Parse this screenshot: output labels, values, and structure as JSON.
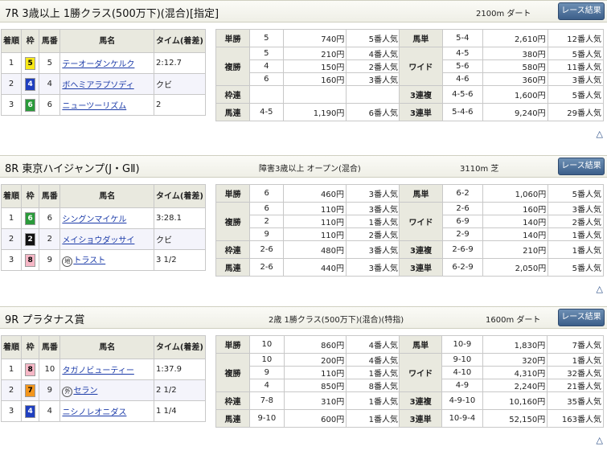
{
  "races": [
    {
      "title": "7R 3歳以上 1勝クラス(500万下)(混合)[指定]",
      "condition": "",
      "distance": "2100m ダート",
      "button": "レース結果",
      "headers": [
        "着順",
        "枠",
        "馬番",
        "馬名",
        "タイム(着差)"
      ],
      "results": [
        {
          "pos": "1",
          "waku": "5",
          "num": "5",
          "name": "テーオーダンケルク",
          "time": "2:12.7"
        },
        {
          "pos": "2",
          "waku": "4",
          "num": "4",
          "name": "ボヘミアラプソディ",
          "time": "クビ"
        },
        {
          "pos": "3",
          "waku": "6",
          "num": "6",
          "name": "ニューツーリズム",
          "time": "2"
        }
      ],
      "payout_left": [
        {
          "label": "単勝",
          "rows": [
            [
              "5",
              "740円",
              "5番人気"
            ]
          ]
        },
        {
          "label": "複勝",
          "rows": [
            [
              "5",
              "210円",
              "4番人気"
            ],
            [
              "4",
              "150円",
              "2番人気"
            ],
            [
              "6",
              "160円",
              "3番人気"
            ]
          ]
        },
        {
          "label": "枠連",
          "rows": [
            [
              "",
              "",
              ""
            ]
          ]
        },
        {
          "label": "馬連",
          "rows": [
            [
              "4-5",
              "1,190円",
              "6番人気"
            ]
          ]
        }
      ],
      "payout_right": [
        {
          "label": "馬単",
          "rows": [
            [
              "5-4",
              "2,610円",
              "12番人気"
            ]
          ]
        },
        {
          "label": "ワイド",
          "rows": [
            [
              "4-5",
              "380円",
              "5番人気"
            ],
            [
              "5-6",
              "580円",
              "11番人気"
            ],
            [
              "4-6",
              "360円",
              "3番人気"
            ]
          ]
        },
        {
          "label": "3連複",
          "rows": [
            [
              "4-5-6",
              "1,600円",
              "5番人気"
            ]
          ]
        },
        {
          "label": "3連単",
          "rows": [
            [
              "5-4-6",
              "9,240円",
              "29番人気"
            ]
          ]
        }
      ]
    },
    {
      "title": "8R 東京ハイジャンプ(J・GⅡ)",
      "condition": "障害3歳以上 オープン(混合)",
      "distance": "3110m 芝",
      "button": "レース結果",
      "headers": [
        "着順",
        "枠",
        "馬番",
        "馬名",
        "タイム(着差)"
      ],
      "results": [
        {
          "pos": "1",
          "waku": "6",
          "num": "6",
          "name": "シングンマイケル",
          "time": "3:28.1"
        },
        {
          "pos": "2",
          "waku": "2",
          "num": "2",
          "name": "メイショウダッサイ",
          "time": "クビ"
        },
        {
          "pos": "3",
          "waku": "8",
          "num": "9",
          "name": "トラスト",
          "time": "3 1/2",
          "mark": "地"
        }
      ],
      "payout_left": [
        {
          "label": "単勝",
          "rows": [
            [
              "6",
              "460円",
              "3番人気"
            ]
          ]
        },
        {
          "label": "複勝",
          "rows": [
            [
              "6",
              "110円",
              "3番人気"
            ],
            [
              "2",
              "110円",
              "1番人気"
            ],
            [
              "9",
              "110円",
              "2番人気"
            ]
          ]
        },
        {
          "label": "枠連",
          "rows": [
            [
              "2-6",
              "480円",
              "3番人気"
            ]
          ]
        },
        {
          "label": "馬連",
          "rows": [
            [
              "2-6",
              "440円",
              "3番人気"
            ]
          ]
        }
      ],
      "payout_right": [
        {
          "label": "馬単",
          "rows": [
            [
              "6-2",
              "1,060円",
              "5番人気"
            ]
          ]
        },
        {
          "label": "ワイド",
          "rows": [
            [
              "2-6",
              "160円",
              "3番人気"
            ],
            [
              "6-9",
              "140円",
              "2番人気"
            ],
            [
              "2-9",
              "140円",
              "1番人気"
            ]
          ]
        },
        {
          "label": "3連複",
          "rows": [
            [
              "2-6-9",
              "210円",
              "1番人気"
            ]
          ]
        },
        {
          "label": "3連単",
          "rows": [
            [
              "6-2-9",
              "2,050円",
              "5番人気"
            ]
          ]
        }
      ]
    },
    {
      "title": "9R プラタナス賞",
      "condition": "2歳 1勝クラス(500万下)(混合)(特指)",
      "distance": "1600m ダート",
      "button": "レース結果",
      "headers": [
        "着順",
        "枠",
        "馬番",
        "馬名",
        "タイム(着差)"
      ],
      "results": [
        {
          "pos": "1",
          "waku": "8",
          "num": "10",
          "name": "タガノビューティー",
          "time": "1:37.9"
        },
        {
          "pos": "2",
          "waku": "7",
          "num": "9",
          "name": "セラン",
          "time": "2 1/2",
          "mark": "外"
        },
        {
          "pos": "3",
          "waku": "4",
          "num": "4",
          "name": "ニシノレオニダス",
          "time": "1 1/4"
        }
      ],
      "payout_left": [
        {
          "label": "単勝",
          "rows": [
            [
              "10",
              "860円",
              "4番人気"
            ]
          ]
        },
        {
          "label": "複勝",
          "rows": [
            [
              "10",
              "200円",
              "4番人気"
            ],
            [
              "9",
              "110円",
              "1番人気"
            ],
            [
              "4",
              "850円",
              "8番人気"
            ]
          ]
        },
        {
          "label": "枠連",
          "rows": [
            [
              "7-8",
              "310円",
              "1番人気"
            ]
          ]
        },
        {
          "label": "馬連",
          "rows": [
            [
              "9-10",
              "600円",
              "1番人気"
            ]
          ]
        }
      ],
      "payout_right": [
        {
          "label": "馬単",
          "rows": [
            [
              "10-9",
              "1,830円",
              "7番人気"
            ]
          ]
        },
        {
          "label": "ワイド",
          "rows": [
            [
              "9-10",
              "320円",
              "1番人気"
            ],
            [
              "4-10",
              "4,310円",
              "32番人気"
            ],
            [
              "4-9",
              "2,240円",
              "21番人気"
            ]
          ]
        },
        {
          "label": "3連複",
          "rows": [
            [
              "4-9-10",
              "10,160円",
              "35番人気"
            ]
          ]
        },
        {
          "label": "3連単",
          "rows": [
            [
              "10-9-4",
              "52,150円",
              "163番人気"
            ]
          ]
        }
      ]
    }
  ],
  "waku_colors": {
    "1": {
      "bg": "#ffffff",
      "fg": "#000000"
    },
    "2": {
      "bg": "#111111",
      "fg": "#ffffff"
    },
    "3": {
      "bg": "#e83a2f",
      "fg": "#ffffff"
    },
    "4": {
      "bg": "#1f3fbf",
      "fg": "#ffffff"
    },
    "5": {
      "bg": "#f7e81a",
      "fg": "#000000"
    },
    "6": {
      "bg": "#2a9a3a",
      "fg": "#ffffff"
    },
    "7": {
      "bg": "#f3961c",
      "fg": "#000000"
    },
    "8": {
      "bg": "#f6b7c6",
      "fg": "#000000"
    }
  },
  "back_to_top_icon": "triangle-up-icon"
}
